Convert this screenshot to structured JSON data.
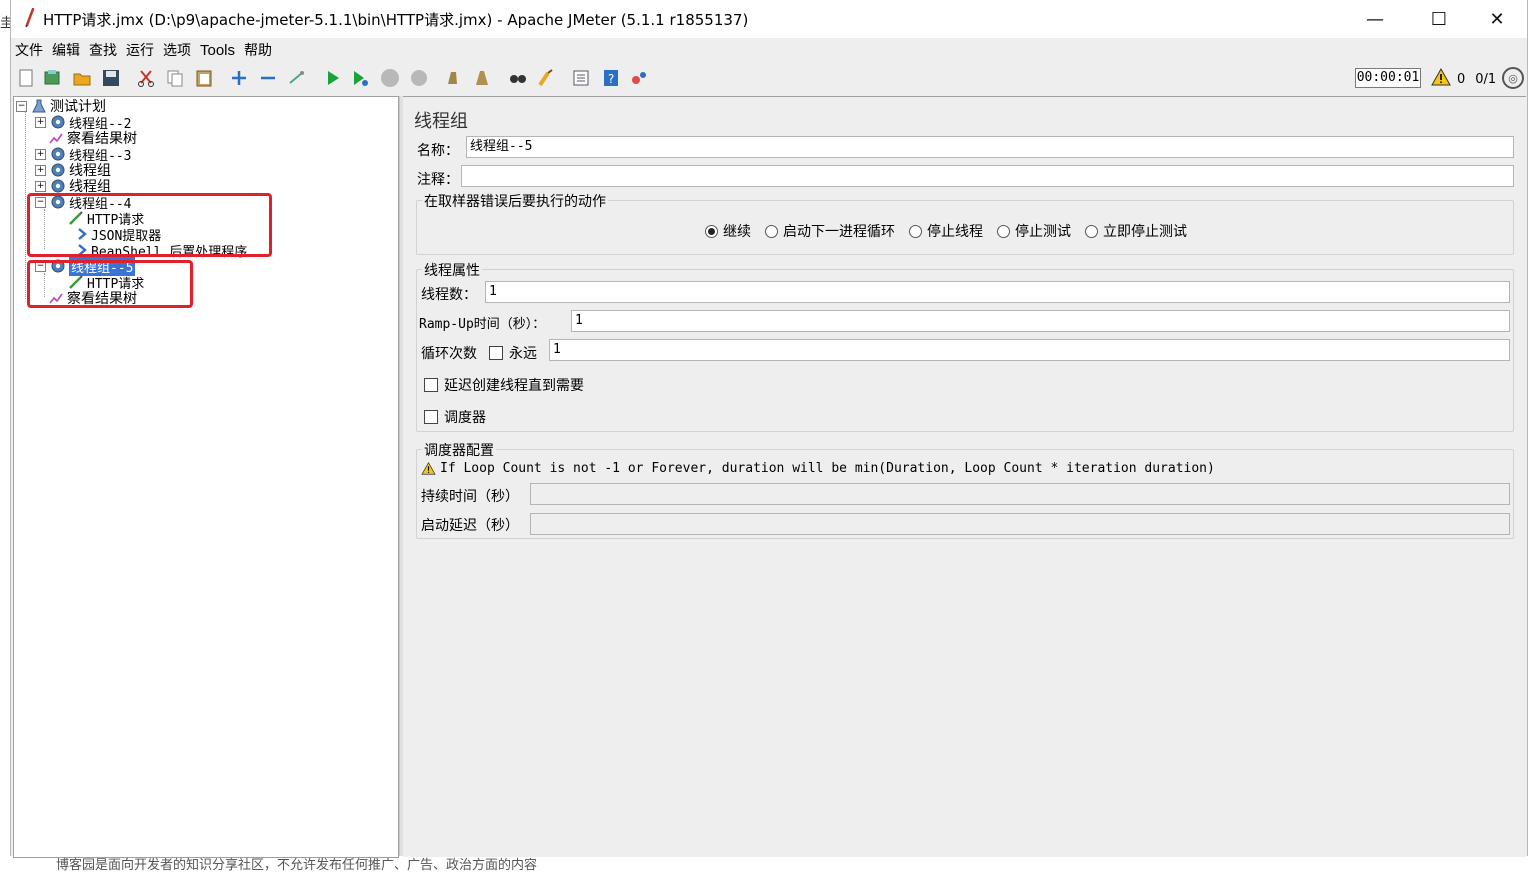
{
  "window": {
    "title": "HTTP请求.jmx (D:\\p9\\apache-jmeter-5.1.1\\bin\\HTTP请求.jmx) - Apache JMeter (5.1.1 r1855137)",
    "minimize": "—",
    "maximize": "☐",
    "close": "✕"
  },
  "menu": [
    "文件",
    "编辑",
    "查找",
    "运行",
    "选项",
    "Tools",
    "帮助"
  ],
  "toolbar": {
    "timer": "00:00:01",
    "warning_count": "0",
    "threads": "0/1"
  },
  "tree": {
    "root": "测试计划",
    "nodes": [
      {
        "label": "线程组--2"
      },
      {
        "label": "察看结果树"
      },
      {
        "label": "线程组--3"
      },
      {
        "label": "线程组"
      },
      {
        "label": "线程组"
      },
      {
        "label": "线程组--4"
      },
      {
        "label": "HTTP请求"
      },
      {
        "label": "JSON提取器"
      },
      {
        "label": "BeanShell 后置处理程序"
      },
      {
        "label": "线程组--5"
      },
      {
        "label": "HTTP请求"
      },
      {
        "label": "察看结果树"
      }
    ]
  },
  "panel": {
    "title": "线程组",
    "name_label": "名称：",
    "name_value": "线程组--5",
    "comment_label": "注释：",
    "comment_value": "",
    "error_group_title": "在取样器错误后要执行的动作",
    "error_options": [
      "继续",
      "启动下一进程循环",
      "停止线程",
      "停止测试",
      "立即停止测试"
    ],
    "error_selected": "继续",
    "props_title": "线程属性",
    "threads_label": "线程数：",
    "threads_value": "1",
    "rampup_label": "Ramp-Up时间（秒）：",
    "rampup_value": "1",
    "loop_label": "循环次数",
    "forever_label": "永远",
    "loop_value": "1",
    "delay_label": "延迟创建线程直到需要",
    "scheduler_label": "调度器",
    "sched_title": "调度器配置",
    "sched_warning": "If Loop Count is not -1 or Forever, duration will be min(Duration, Loop Count * iteration duration)",
    "duration_label": "持续时间（秒）",
    "startup_label": "启动延迟（秒）"
  },
  "background": {
    "bottom_text": "博客园是面向开发者的知识分享社区，不允许发布任何推广、广告、政治方面的内容"
  }
}
